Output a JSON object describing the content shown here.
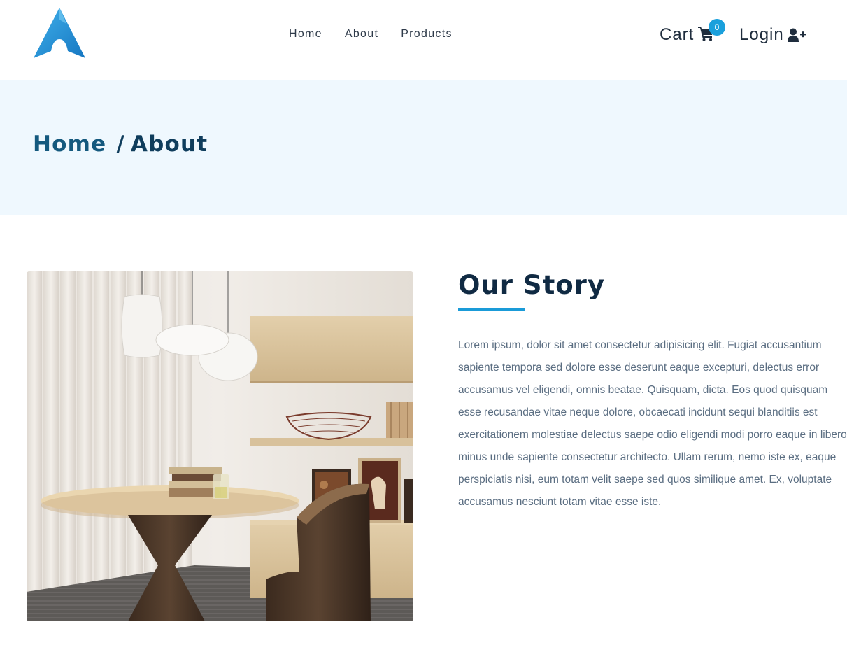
{
  "brand": {
    "logo_icon": "arch-logo-icon",
    "accent_color": "#1a9bd8"
  },
  "nav": {
    "items": [
      {
        "label": "Home"
      },
      {
        "label": "About"
      },
      {
        "label": "Products"
      }
    ]
  },
  "cart": {
    "label": "Cart",
    "icon": "shopping-cart-icon",
    "count": "0",
    "badge_color": "#1aa0dc"
  },
  "login": {
    "label": "Login",
    "icon": "user-plus-icon"
  },
  "breadcrumb": {
    "home": "Home",
    "separator": "/",
    "current": "About"
  },
  "story": {
    "title": "Our Story",
    "body": "Lorem ipsum, dolor sit amet consectetur adipisicing elit. Fugiat accusantium sapiente tempora sed dolore esse deserunt eaque excepturi, delectus error accusamus vel eligendi, omnis beatae. Quisquam, dicta. Eos quod quisquam esse recusandae vitae neque dolore, obcaecati incidunt sequi blanditiis est exercitationem molestiae delectus saepe odio eligendi modi porro eaque in libero minus unde sapiente consectetur architecto. Ullam rerum, nemo iste ex, eaque perspiciatis nisi, eum totam velit saepe sed quos similique amet. Ex, voluptate accusamus nesciunt totam vitae esse iste.",
    "image": "interior-dining-room-photo"
  }
}
